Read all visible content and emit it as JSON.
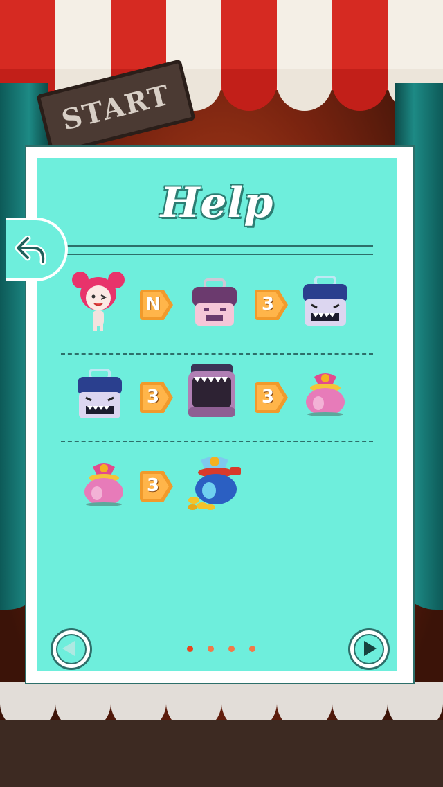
{
  "background": {
    "sign_text": "START"
  },
  "help": {
    "title": "Help",
    "back_icon": "undo-arrow-icon"
  },
  "rows": [
    {
      "items": [
        "girl-character-icon",
        "pink-box-icon",
        "blue-box-monster-icon"
      ],
      "badges": [
        "N",
        "3"
      ]
    },
    {
      "items": [
        "blue-box-monster-icon",
        "open-trap-box-icon",
        "pink-treasure-bag-icon"
      ],
      "badges": [
        "3",
        "3"
      ]
    },
    {
      "items": [
        "pink-treasure-bag-icon",
        "gold-coin-bag-icon"
      ],
      "badges": [
        "3"
      ]
    }
  ],
  "pagination": {
    "pages": 4,
    "current": 1,
    "active_color": "#e8451e",
    "inactive_color": "#e8451e"
  },
  "nav": {
    "prev_icon": "arrow-left-icon",
    "next_icon": "arrow-right-icon"
  },
  "colors": {
    "panel_bg": "#6eeedc",
    "accent": "#2d6f6a",
    "badge": "#f19a2b"
  }
}
